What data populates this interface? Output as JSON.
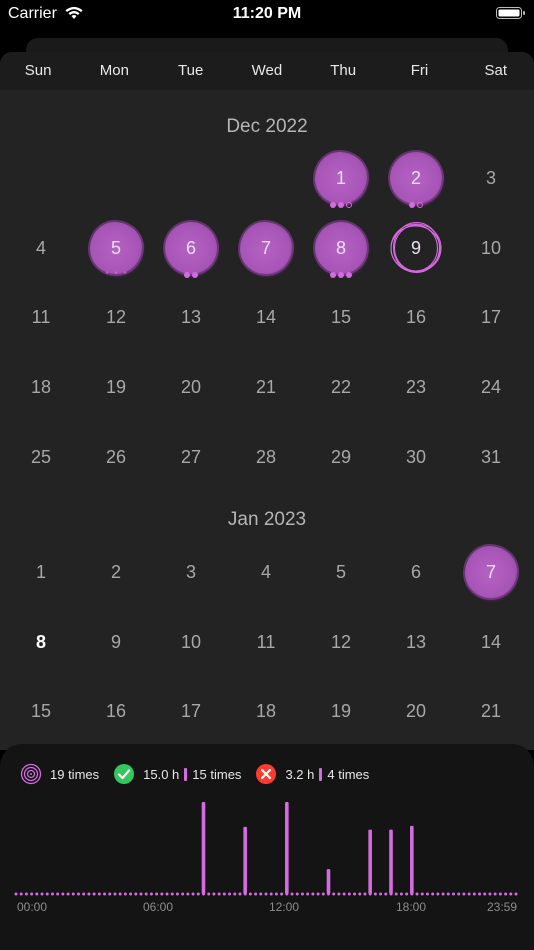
{
  "status_bar": {
    "carrier": "Carrier",
    "time": "11:20 PM"
  },
  "weekdays": [
    "Sun",
    "Mon",
    "Tue",
    "Wed",
    "Thu",
    "Fri",
    "Sat"
  ],
  "months": [
    {
      "title": "Dec 2022",
      "first_weekday": 4,
      "days": 31,
      "marked": {
        "1": {
          "style": "filled",
          "dots": [
            "filled",
            "filled",
            "hollow"
          ]
        },
        "2": {
          "style": "filled",
          "dots": [
            "filled",
            "hollow"
          ]
        },
        "5": {
          "style": "filled",
          "dots": [
            "star",
            "star",
            "star"
          ]
        },
        "6": {
          "style": "filled",
          "dots": [
            "filled",
            "filled"
          ]
        },
        "7": {
          "style": "filled",
          "dots": []
        },
        "8": {
          "style": "filled",
          "dots": [
            "filled",
            "filled",
            "filled"
          ]
        },
        "9": {
          "style": "ring",
          "dots": []
        }
      }
    },
    {
      "title": "Jan 2023",
      "first_weekday": 0,
      "days": 21,
      "marked": {
        "7": {
          "style": "filled",
          "dots": []
        }
      },
      "today": 8
    }
  ],
  "stats": {
    "sessions": "19 times",
    "success_hours": "15.0 h",
    "success_count": "15 times",
    "fail_hours": "3.2 h",
    "fail_count": "4 times"
  },
  "colors": {
    "accent": "#d56be0",
    "success": "#34c759",
    "fail": "#ff3b30"
  },
  "chart_data": {
    "type": "bar",
    "x_ticks": [
      "00:00",
      "06:00",
      "12:00",
      "18:00",
      "23:59"
    ],
    "xlim_hours": [
      0,
      24
    ],
    "bars": [
      {
        "hour": 9.0,
        "value": 1.0
      },
      {
        "hour": 11.0,
        "value": 0.73
      },
      {
        "hour": 13.0,
        "value": 1.0
      },
      {
        "hour": 15.0,
        "value": 0.27
      },
      {
        "hour": 17.0,
        "value": 0.7
      },
      {
        "hour": 18.0,
        "value": 0.7
      },
      {
        "hour": 19.0,
        "value": 0.74
      }
    ]
  }
}
